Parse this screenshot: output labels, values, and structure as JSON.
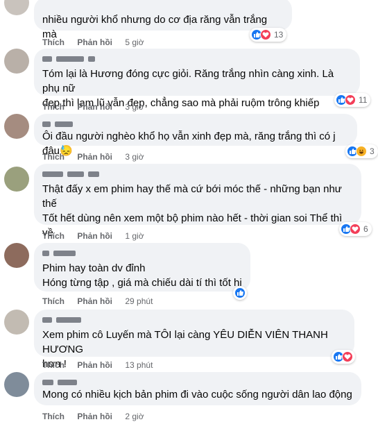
{
  "labels": {
    "like": "Thích",
    "reply": "Phản hồi"
  },
  "comments": [
    {
      "text": "nhiều người khổ nhưng do cơ địa răng vẫn trắng mà",
      "time": "5 giờ",
      "reactions": [
        "like-icon",
        "love-icon"
      ],
      "count": "13"
    },
    {
      "text": "Tóm lại là Hương đóng cực giỏi. Răng trắng nhìn càng xinh. Là phụ nữ\nđẹp thì lam lũ vẫn đẹp, chẳng sao mà phải ruộm trông khiếp",
      "time": "3 giờ",
      "reactions": [
        "like-icon",
        "love-icon"
      ],
      "count": "11"
    },
    {
      "text": "Ôi đầu người nghèo khổ họ vẫn xinh đẹp mà, răng trắng thì có j đâu😓",
      "time": "3 giờ",
      "reactions": [
        "like-icon",
        "haha-icon"
      ],
      "count": "3"
    },
    {
      "text": "Thật đấy x em phim hay thế mà cứ bới móc thế - những bạn như thế\nTốt hết dùng nên xem một bộ phim nào hết - thời gian soi Thể thì về\nsoi gương lại mình đi bạn nhé",
      "time": "1 giờ",
      "reactions": [
        "like-icon",
        "love-icon"
      ],
      "count": "6"
    },
    {
      "text": "Phim hay toàn dv đỉnh\nHóng từng tập , giá mà chiếu dài tí thì tốt hi",
      "time": "29 phút",
      "reactions": [
        "like-icon"
      ],
      "count": ""
    },
    {
      "text": "Xem phim cô Luyến mà TÔI lại càng YÊU DIỄN VIÊN THANH HƯƠNG\nhơn !",
      "time": "13 phút",
      "reactions": [
        "like-icon",
        "love-icon"
      ],
      "count": ""
    },
    {
      "text": "Mong có nhiều kịch bản phim đi vào cuộc sống người dân lao động",
      "time": "2 giờ",
      "reactions": [],
      "count": ""
    }
  ],
  "colors": {
    "like": "#1877f2",
    "love": "#f33e58",
    "haha": "#f7b125",
    "bubble": "#f0f2f5",
    "meta": "#65676b"
  }
}
